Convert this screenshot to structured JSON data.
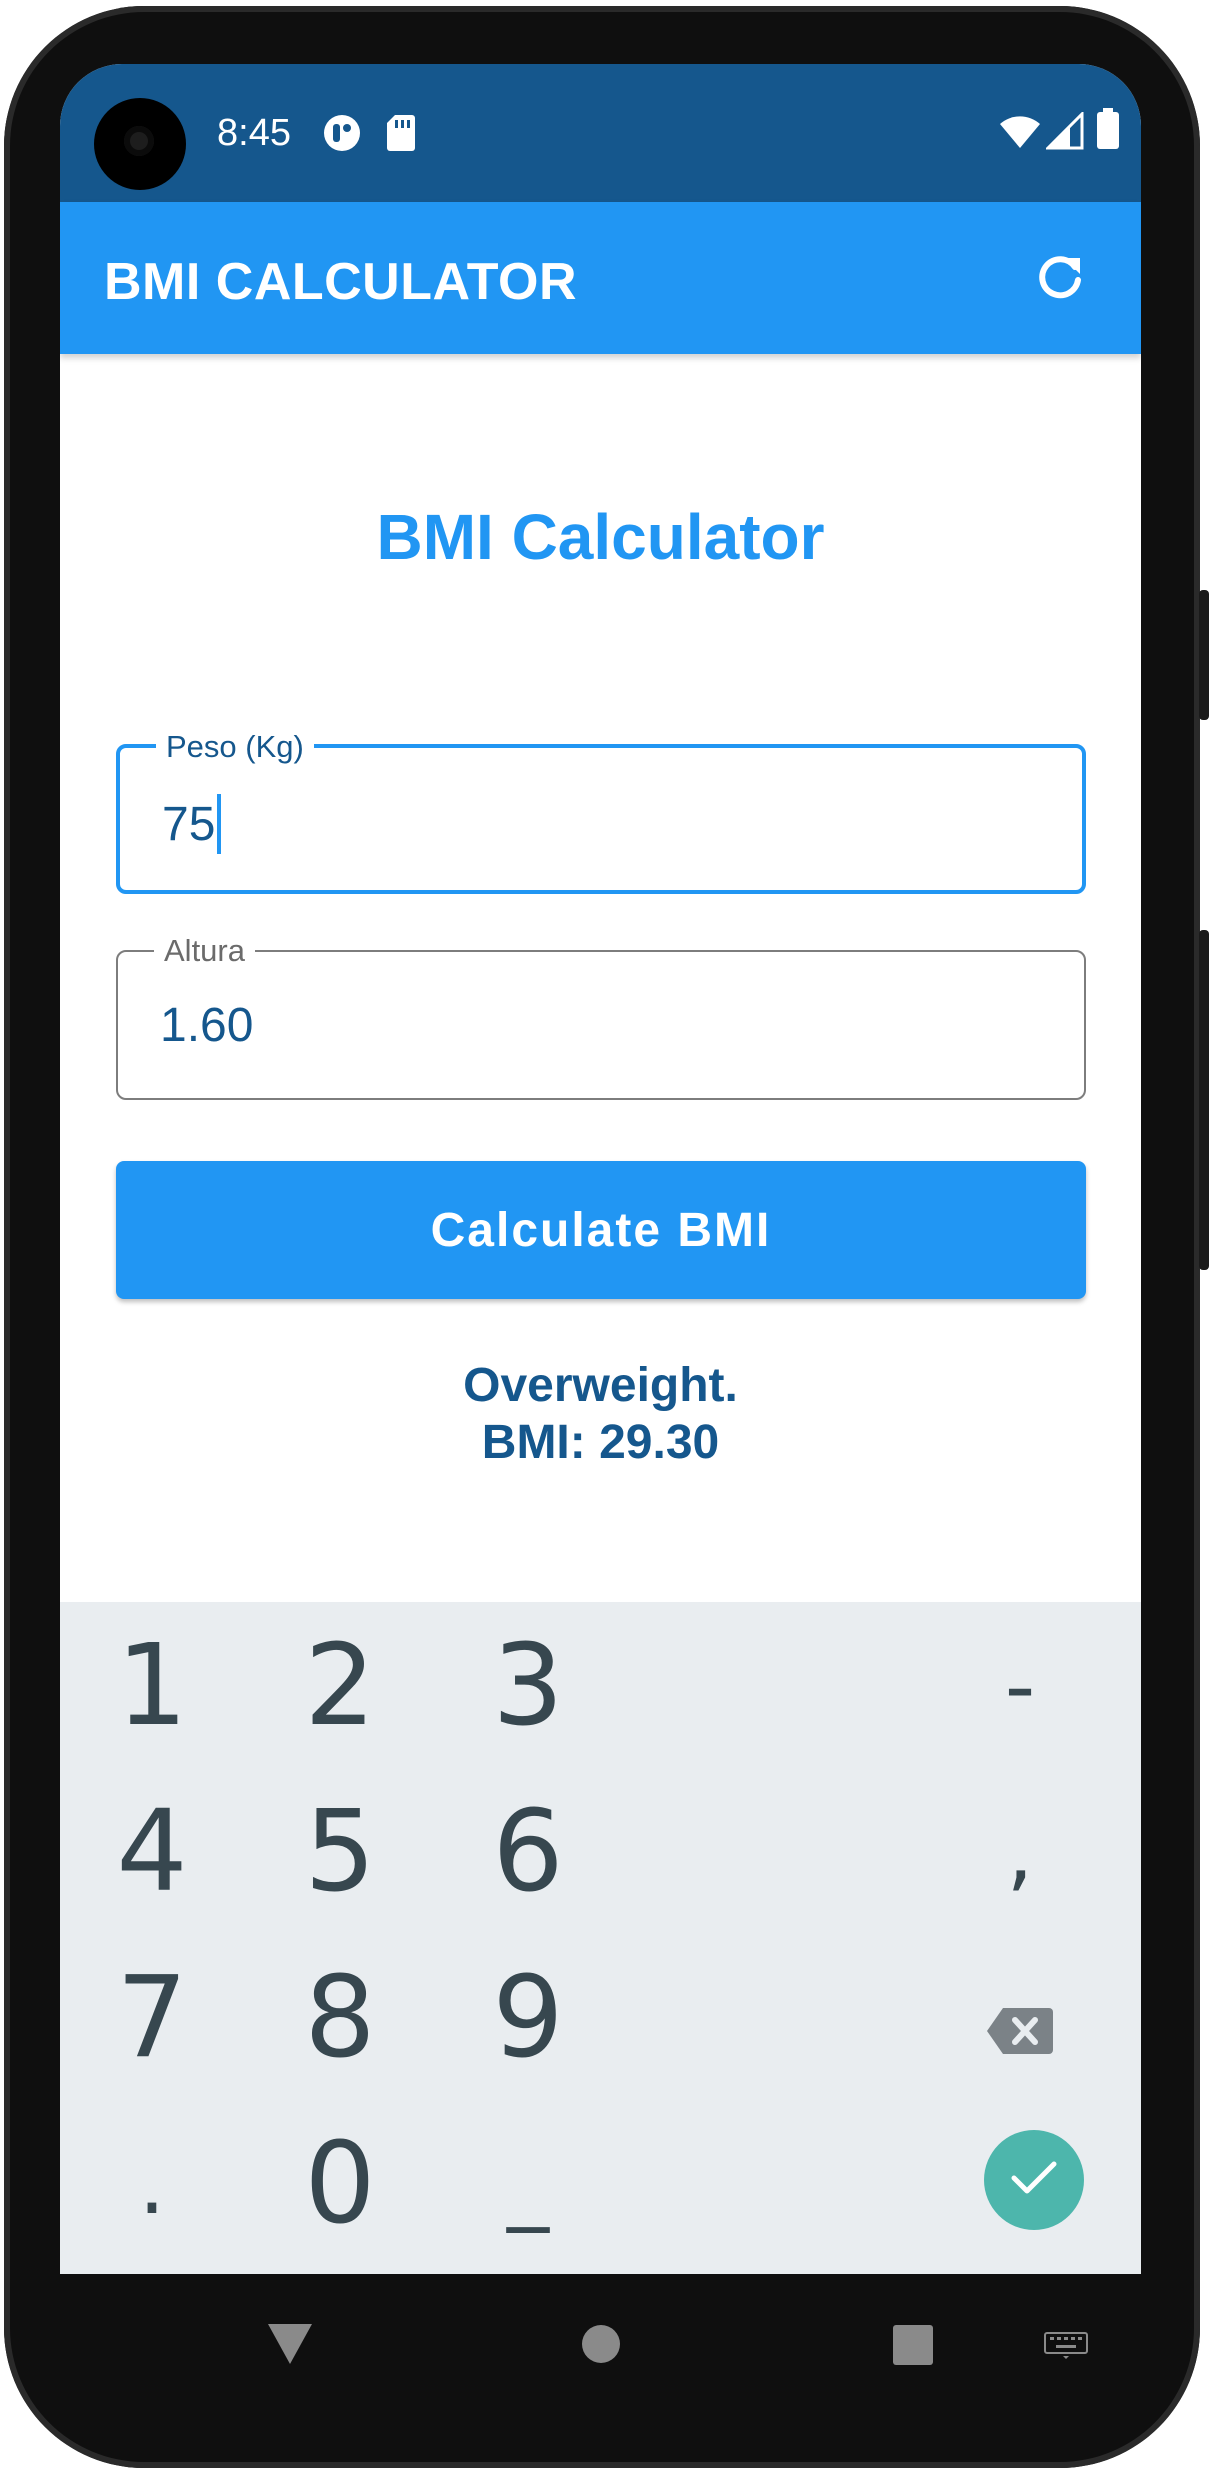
{
  "status_bar": {
    "time": "8:45",
    "icons": [
      "notification-app-icon",
      "sd-card-icon",
      "wifi-icon",
      "signal-icon",
      "battery-icon"
    ]
  },
  "app_bar": {
    "title": "BMI CALCULATOR",
    "action_icon": "refresh-icon"
  },
  "main": {
    "heading": "BMI Calculator",
    "weight_field": {
      "label": "Peso (Kg)",
      "value": "75"
    },
    "height_field": {
      "label": "Altura",
      "value": "1.60"
    },
    "calculate_label": "Calculate BMI",
    "result_line1": "Overweight.",
    "result_line2": "BMI: 29.30"
  },
  "keyboard": {
    "keys": {
      "k1": "1",
      "k2": "2",
      "k3": "3",
      "minus": "-",
      "k4": "4",
      "k5": "5",
      "k6": "6",
      "comma": ",",
      "k7": "7",
      "k8": "8",
      "k9": "9",
      "dot": ".",
      "k0": "0",
      "underscore": "_"
    },
    "backspace_icon": "backspace-icon",
    "done_icon": "check-icon"
  },
  "nav_bar": {
    "icons": [
      "back-icon",
      "home-icon",
      "recents-icon",
      "keyboard-switch-icon"
    ]
  },
  "colors": {
    "primary": "#2196f3",
    "primary_dark": "#15578d",
    "keyboard_bg": "#e9edf0",
    "key_text": "#37474f",
    "done_key": "#4db6ac"
  }
}
